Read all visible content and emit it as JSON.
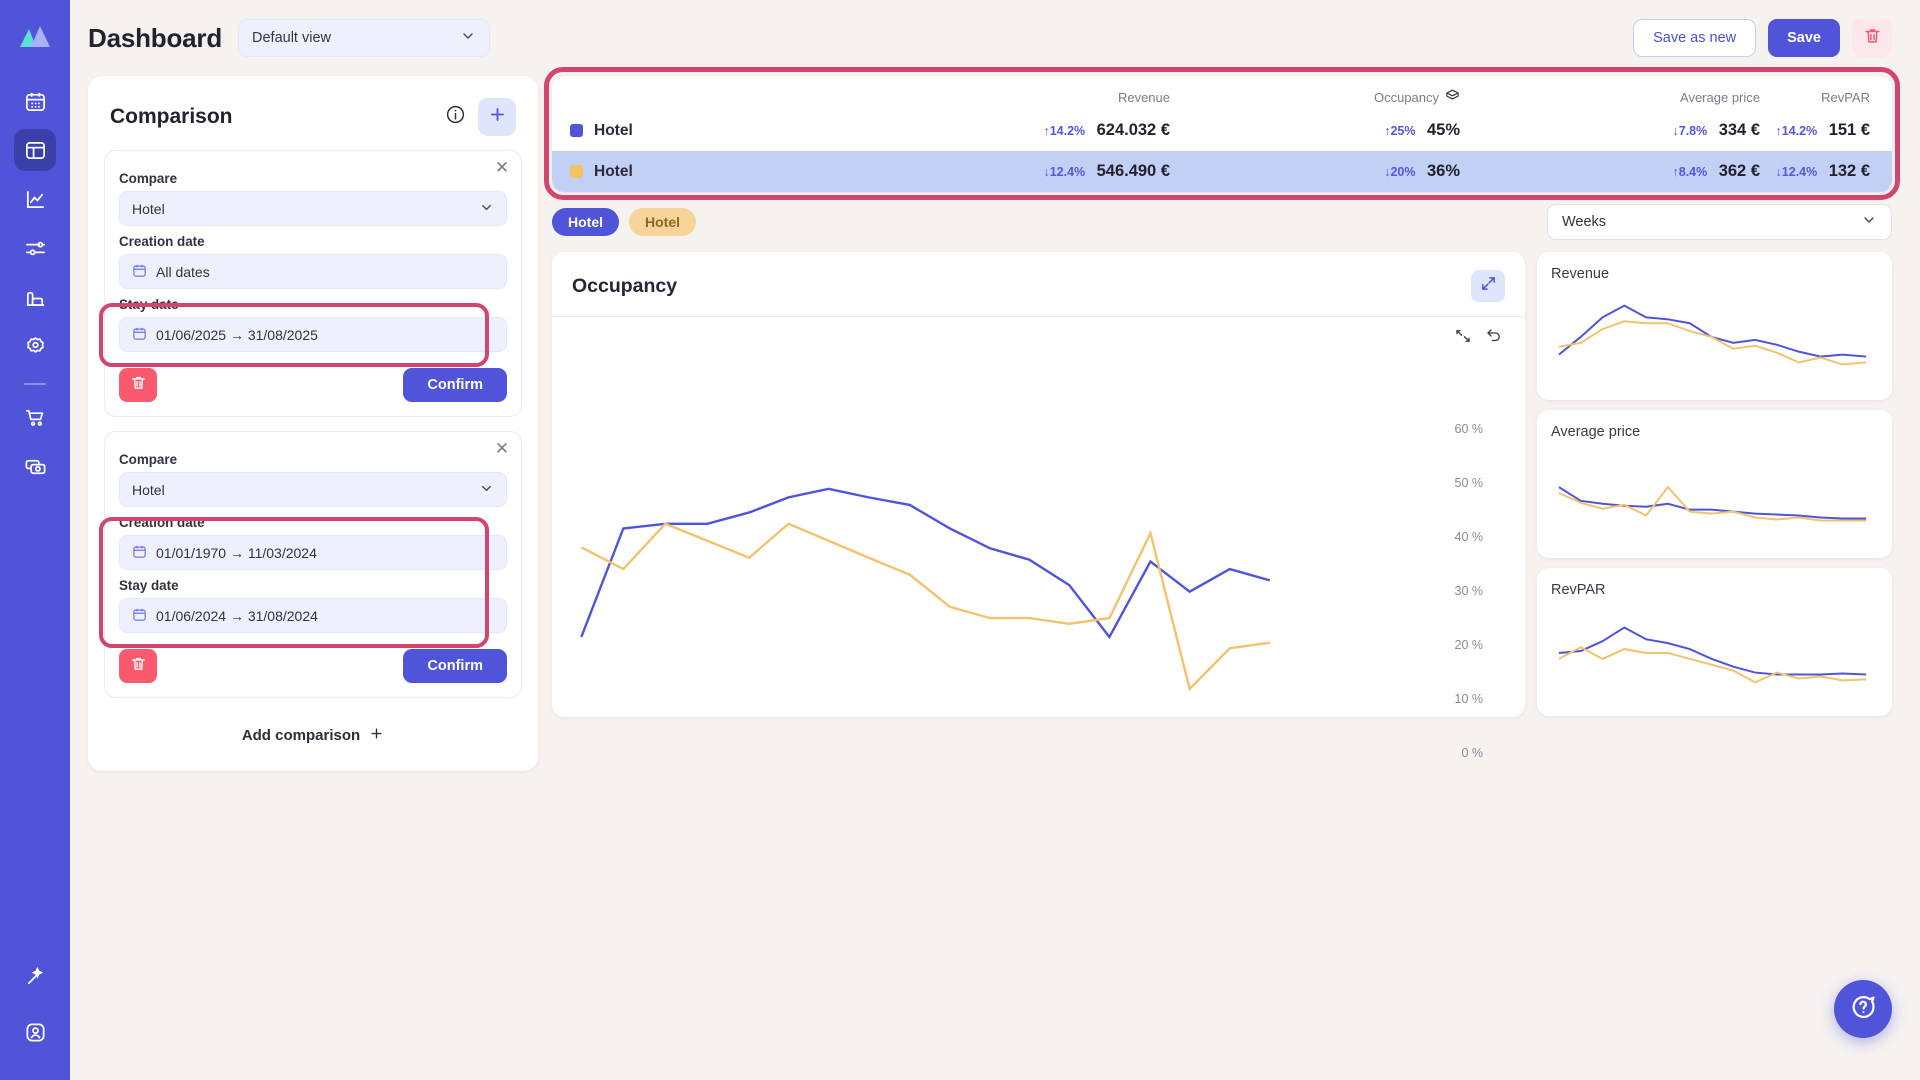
{
  "header": {
    "title": "Dashboard",
    "view_selector": {
      "value": "Default view",
      "icon": "chevron-down-icon"
    },
    "save_as_new_label": "Save as new",
    "save_label": "Save",
    "delete_icon": "trash-icon"
  },
  "sidebar": {
    "logo": "mountains-logo",
    "items": [
      {
        "name": "calendar-icon",
        "active": false
      },
      {
        "name": "dashboard-icon",
        "active": true
      },
      {
        "name": "line-chart-icon",
        "active": false
      },
      {
        "name": "sliders-icon",
        "active": false
      },
      {
        "name": "bar-chart-icon",
        "active": false
      },
      {
        "name": "gear-icon",
        "active": false
      },
      {
        "name": "divider",
        "active": false
      },
      {
        "name": "shopping-cart-icon",
        "active": false
      },
      {
        "name": "money-icon",
        "active": false
      }
    ],
    "bottom_items": [
      {
        "name": "magic-wand-icon"
      },
      {
        "name": "user-account-icon"
      }
    ]
  },
  "comparison": {
    "title": "Comparison",
    "info_icon": "info-icon",
    "add_icon": "plus-icon",
    "add_comparison_label": "Add comparison",
    "cards": [
      {
        "close_icon": "close-icon",
        "compare_label": "Compare",
        "compare_value": "Hotel",
        "creation_date_label": "Creation date",
        "creation_date_value": "All dates",
        "stay_date_label": "Stay date",
        "stay_date_value": "01/06/2025 → 31/08/2025",
        "delete_icon": "trash-icon",
        "confirm_label": "Confirm",
        "highlight": "stay-date"
      },
      {
        "close_icon": "close-icon",
        "compare_label": "Compare",
        "compare_value": "Hotel",
        "creation_date_label": "Creation date",
        "creation_date_value": "01/01/1970 → 11/03/2024",
        "stay_date_label": "Stay date",
        "stay_date_value": "01/06/2024 → 31/08/2024",
        "delete_icon": "trash-icon",
        "confirm_label": "Confirm",
        "highlight": "both-dates"
      }
    ]
  },
  "kpi": {
    "columns": [
      {
        "label": "Revenue",
        "icon": null
      },
      {
        "label": "Occupancy",
        "icon": "box-icon"
      },
      {
        "label": "Average price",
        "icon": null
      },
      {
        "label": "RevPAR",
        "icon": null
      }
    ],
    "rows": [
      {
        "name": "Hotel",
        "color": "#4f54d8",
        "highlighted": false,
        "cells": [
          {
            "delta": "↑14.2%",
            "value": "624.032 €"
          },
          {
            "delta": "↑25%",
            "value": "45%"
          },
          {
            "delta": "↓7.8%",
            "value": "334 €"
          },
          {
            "delta": "↑14.2%",
            "value": "151 €"
          }
        ]
      },
      {
        "name": "Hotel",
        "color": "#f4c265",
        "highlighted": true,
        "cells": [
          {
            "delta": "↓12.4%",
            "value": "546.490 €"
          },
          {
            "delta": "↓20%",
            "value": "36%"
          },
          {
            "delta": "↑8.4%",
            "value": "362 €"
          },
          {
            "delta": "↓12.4%",
            "value": "132 €"
          }
        ]
      }
    ]
  },
  "chips": [
    {
      "label": "Hotel",
      "color": "#4f54d8",
      "text_color": "#ffffff"
    },
    {
      "label": "Hotel",
      "color": "#f6d49a",
      "text_color": "#8a6a22"
    }
  ],
  "period_selector": {
    "value": "Weeks",
    "icon": "chevron-down-icon"
  },
  "main_chart": {
    "title": "Occupancy",
    "expand_icon": "expand-icon",
    "tool_icons": [
      "reset-zoom-icon",
      "undo-icon"
    ]
  },
  "side_charts": [
    {
      "title": "Revenue"
    },
    {
      "title": "Average price"
    },
    {
      "title": "RevPAR"
    }
  ],
  "fab": {
    "icon": "help-chat-icon"
  },
  "chart_data": {
    "type": "line",
    "title": "Occupancy",
    "xlabel": "",
    "ylabel": "",
    "ylim": [
      0,
      65
    ],
    "grid": false,
    "legend": [
      "Hotel",
      "Hotel"
    ],
    "ytick_labels": [
      "60 %",
      "50 %",
      "40 %",
      "30 %",
      "20 %",
      "10 %",
      "0 %"
    ],
    "ytick_values": [
      60,
      50,
      40,
      30,
      20,
      10,
      0
    ],
    "x": [
      1,
      2,
      3,
      4,
      5,
      6,
      7,
      8,
      9,
      10,
      11,
      12,
      13,
      14,
      15,
      16,
      17
    ],
    "series": [
      {
        "name": "Hotel",
        "color": "#4f54d8",
        "values": [
          25,
          47,
          48,
          48,
          50,
          52,
          53,
          52,
          51,
          48,
          45,
          43,
          39,
          31,
          41,
          37,
          40,
          38
        ]
      },
      {
        "name": "Hotel",
        "color": "#f0c36d",
        "values": [
          44,
          41,
          48,
          45,
          42,
          48,
          45,
          42,
          39,
          33,
          31,
          31,
          30,
          31,
          46,
          15,
          22,
          23
        ]
      }
    ],
    "sparklines": [
      {
        "title": "Revenue",
        "series": [
          {
            "name": "Hotel",
            "color": "#4f54d8",
            "values": [
              30,
              52,
              70,
              82,
              70,
              68,
              64,
              50,
              44,
              47,
              42,
              35,
              30
            ]
          },
          {
            "name": "Hotel",
            "color": "#f0c36d",
            "values": [
              38,
              44,
              58,
              66,
              64,
              64,
              56,
              50,
              38,
              41,
              34,
              24,
              29
            ]
          }
        ]
      },
      {
        "title": "Average price",
        "series": [
          {
            "name": "Hotel",
            "color": "#4f54d8",
            "values": [
              52,
              38,
              36,
              34,
              33,
              36,
              30,
              30,
              28,
              26,
              25,
              24,
              22
            ]
          },
          {
            "name": "Hotel",
            "color": "#f0c36d",
            "values": [
              46,
              36,
              30,
              34,
              24,
              52,
              28,
              26,
              28,
              22,
              20,
              22,
              20
            ]
          }
        ]
      },
      {
        "title": "RevPAR",
        "series": [
          {
            "name": "Hotel",
            "color": "#4f54d8",
            "values": [
              46,
              48,
              58,
              74,
              62,
              58,
              52,
              42,
              34,
              28,
              26,
              26,
              26
            ]
          },
          {
            "name": "Hotel",
            "color": "#f0c36d",
            "values": [
              40,
              52,
              40,
              50,
              46,
              46,
              40,
              34,
              28,
              16,
              26,
              20,
              22
            ]
          }
        ]
      }
    ]
  }
}
